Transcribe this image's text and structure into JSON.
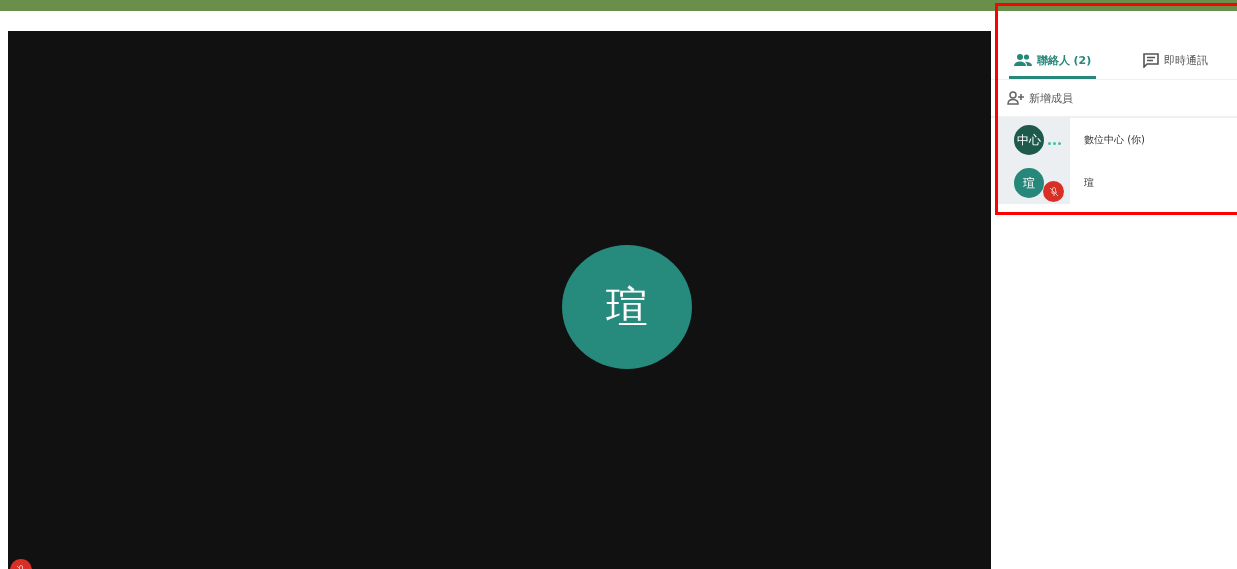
{
  "tabs": [
    {
      "label": "聯絡人 (2)",
      "selected": true
    },
    {
      "label": "即時通訊",
      "selected": false
    }
  ],
  "add_member": "新增成員",
  "participants": [
    {
      "initials": "中心",
      "name": "數位中心 (你)",
      "color": "#1d5a4b",
      "kind": "speaking"
    },
    {
      "initials": "瑄",
      "name": "瑄",
      "color": "#26877a",
      "kind": "muted"
    }
  ],
  "main_video": {
    "initials": "瑄",
    "color": "#268a7c"
  },
  "self_view": {
    "muted": true
  }
}
